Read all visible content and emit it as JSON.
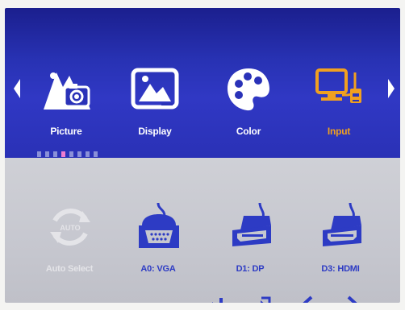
{
  "menu": {
    "items": [
      {
        "label": "Picture",
        "icon": "picture-icon",
        "selected": false
      },
      {
        "label": "Display",
        "icon": "display-icon",
        "selected": false
      },
      {
        "label": "Color",
        "icon": "palette-icon",
        "selected": false
      },
      {
        "label": "Input",
        "icon": "input-icon",
        "selected": true
      }
    ],
    "arrows": {
      "left": "left-arrow-icon",
      "right": "right-arrow-icon"
    },
    "page_indicator": {
      "total": 8,
      "active_index": 3
    }
  },
  "submenu": {
    "items": [
      {
        "label": "Auto Select",
        "icon": "auto-select-icon",
        "enabled": false
      },
      {
        "label": "A0: VGA",
        "icon": "vga-connector-icon",
        "enabled": true
      },
      {
        "label": "D1: DP",
        "icon": "displayport-connector-icon",
        "enabled": true
      },
      {
        "label": "D3: HDMI",
        "icon": "hdmi-connector-icon",
        "enabled": true
      }
    ]
  },
  "nav": {
    "buttons": [
      "enter-icon",
      "exit-icon",
      "left-chevron-icon",
      "right-chevron-icon"
    ]
  },
  "colors": {
    "top_panel": "#2a32b8",
    "bottom_panel": "#c6c7cf",
    "selected_label": "#f0a020",
    "label": "#ffffff",
    "submenu_label": "#2d3bc4",
    "disabled": "#e4e4e8",
    "indicator_active": "#f07cd0",
    "indicator_inactive": "#8a90d8"
  }
}
